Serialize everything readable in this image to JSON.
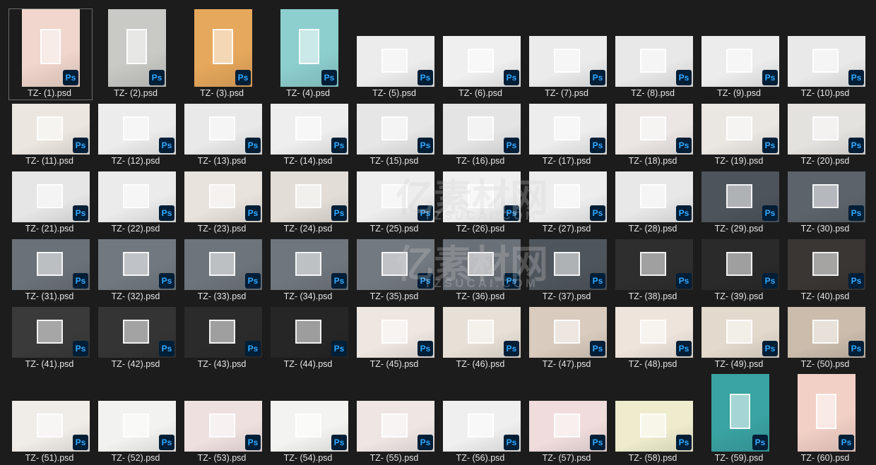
{
  "files": [
    {
      "name": "TZ- (1).psd",
      "shape": "portrait",
      "tone": "#f0d6cc",
      "selected": true
    },
    {
      "name": "TZ- (2).psd",
      "shape": "portrait",
      "tone": "#c9c9c5"
    },
    {
      "name": "TZ- (3).psd",
      "shape": "portrait",
      "tone": "#e6a85c"
    },
    {
      "name": "TZ- (4).psd",
      "shape": "portrait",
      "tone": "#8dcfcf"
    },
    {
      "name": "TZ- (5).psd",
      "shape": "landscape",
      "tone": "#ececec"
    },
    {
      "name": "TZ- (6).psd",
      "shape": "landscape",
      "tone": "#efefef"
    },
    {
      "name": "TZ- (7).psd",
      "shape": "landscape",
      "tone": "#ebebeb"
    },
    {
      "name": "TZ- (8).psd",
      "shape": "landscape",
      "tone": "#e8e8e8"
    },
    {
      "name": "TZ- (9).psd",
      "shape": "landscape",
      "tone": "#ececec"
    },
    {
      "name": "TZ- (10).psd",
      "shape": "landscape",
      "tone": "#e9e9e9"
    },
    {
      "name": "TZ- (11).psd",
      "shape": "landscape",
      "tone": "#ebe6df"
    },
    {
      "name": "TZ- (12).psd",
      "shape": "landscape",
      "tone": "#ececec"
    },
    {
      "name": "TZ- (13).psd",
      "shape": "landscape",
      "tone": "#e9e9e9"
    },
    {
      "name": "TZ- (14).psd",
      "shape": "landscape",
      "tone": "#eeeeee"
    },
    {
      "name": "TZ- (15).psd",
      "shape": "landscape",
      "tone": "#e6e6e6"
    },
    {
      "name": "TZ- (16).psd",
      "shape": "landscape",
      "tone": "#e4e4e4"
    },
    {
      "name": "TZ- (17).psd",
      "shape": "landscape",
      "tone": "#ededed"
    },
    {
      "name": "TZ- (18).psd",
      "shape": "landscape",
      "tone": "#ebe6e4"
    },
    {
      "name": "TZ- (19).psd",
      "shape": "landscape",
      "tone": "#eae6e2"
    },
    {
      "name": "TZ- (20).psd",
      "shape": "landscape",
      "tone": "#e4e2df"
    },
    {
      "name": "TZ- (21).psd",
      "shape": "landscape",
      "tone": "#e6e6e6"
    },
    {
      "name": "TZ- (22).psd",
      "shape": "landscape",
      "tone": "#ebebeb"
    },
    {
      "name": "TZ- (23).psd",
      "shape": "landscape",
      "tone": "#e8e3dc"
    },
    {
      "name": "TZ- (24).psd",
      "shape": "landscape",
      "tone": "#e2ddd6"
    },
    {
      "name": "TZ- (25).psd",
      "shape": "landscape",
      "tone": "#eeeeee"
    },
    {
      "name": "TZ- (26).psd",
      "shape": "landscape",
      "tone": "#f0f0f0"
    },
    {
      "name": "TZ- (27).psd",
      "shape": "landscape",
      "tone": "#ededed"
    },
    {
      "name": "TZ- (28).psd",
      "shape": "landscape",
      "tone": "#e8e8e8"
    },
    {
      "name": "TZ- (29).psd",
      "shape": "landscape",
      "tone": "#4e545c"
    },
    {
      "name": "TZ- (30).psd",
      "shape": "landscape",
      "tone": "#5c636b"
    },
    {
      "name": "TZ- (31).psd",
      "shape": "landscape",
      "tone": "#6b7178"
    },
    {
      "name": "TZ- (32).psd",
      "shape": "landscape",
      "tone": "#727880"
    },
    {
      "name": "TZ- (33).psd",
      "shape": "landscape",
      "tone": "#6e747b"
    },
    {
      "name": "TZ- (34).psd",
      "shape": "landscape",
      "tone": "#70767d"
    },
    {
      "name": "TZ- (35).psd",
      "shape": "landscape",
      "tone": "#737980"
    },
    {
      "name": "TZ- (36).psd",
      "shape": "landscape",
      "tone": "#6a7077"
    },
    {
      "name": "TZ- (37).psd",
      "shape": "landscape",
      "tone": "#4f555c"
    },
    {
      "name": "TZ- (38).psd",
      "shape": "landscape",
      "tone": "#2e2e2e"
    },
    {
      "name": "TZ- (39).psd",
      "shape": "landscape",
      "tone": "#2a2a2a"
    },
    {
      "name": "TZ- (40).psd",
      "shape": "landscape",
      "tone": "#3a3634"
    },
    {
      "name": "TZ- (41).psd",
      "shape": "landscape",
      "tone": "#3a3a3a"
    },
    {
      "name": "TZ- (42).psd",
      "shape": "landscape",
      "tone": "#343434"
    },
    {
      "name": "TZ- (43).psd",
      "shape": "landscape",
      "tone": "#2b2b2b"
    },
    {
      "name": "TZ- (44).psd",
      "shape": "landscape",
      "tone": "#262626"
    },
    {
      "name": "TZ- (45).psd",
      "shape": "landscape",
      "tone": "#ede6e1"
    },
    {
      "name": "TZ- (46).psd",
      "shape": "landscape",
      "tone": "#e7e0d6"
    },
    {
      "name": "TZ- (47).psd",
      "shape": "landscape",
      "tone": "#d9cbbd"
    },
    {
      "name": "TZ- (48).psd",
      "shape": "landscape",
      "tone": "#eee4dc"
    },
    {
      "name": "TZ- (49).psd",
      "shape": "landscape",
      "tone": "#e3d9cc"
    },
    {
      "name": "TZ- (50).psd",
      "shape": "landscape",
      "tone": "#cbbcac"
    },
    {
      "name": "TZ- (51).psd",
      "shape": "landscape",
      "tone": "#f0ece8"
    },
    {
      "name": "TZ- (52).psd",
      "shape": "landscape",
      "tone": "#f2f2f0"
    },
    {
      "name": "TZ- (53).psd",
      "shape": "landscape",
      "tone": "#efe0e0"
    },
    {
      "name": "TZ- (54).psd",
      "shape": "landscape",
      "tone": "#f3f3f1"
    },
    {
      "name": "TZ- (55).psd",
      "shape": "landscape",
      "tone": "#efe6e4"
    },
    {
      "name": "TZ- (56).psd",
      "shape": "landscape",
      "tone": "#efefef"
    },
    {
      "name": "TZ- (57).psd",
      "shape": "landscape",
      "tone": "#f0dcdc"
    },
    {
      "name": "TZ- (58).psd",
      "shape": "landscape",
      "tone": "#eeeccd"
    },
    {
      "name": "TZ- (59).psd",
      "shape": "portrait",
      "tone": "#3aa3a3"
    },
    {
      "name": "TZ- (60).psd",
      "shape": "portrait",
      "tone": "#f2d0c6"
    }
  ],
  "badge_label": "Ps",
  "watermark": {
    "brand": "亿素材网",
    "url": "TZSUCAI.COM"
  }
}
